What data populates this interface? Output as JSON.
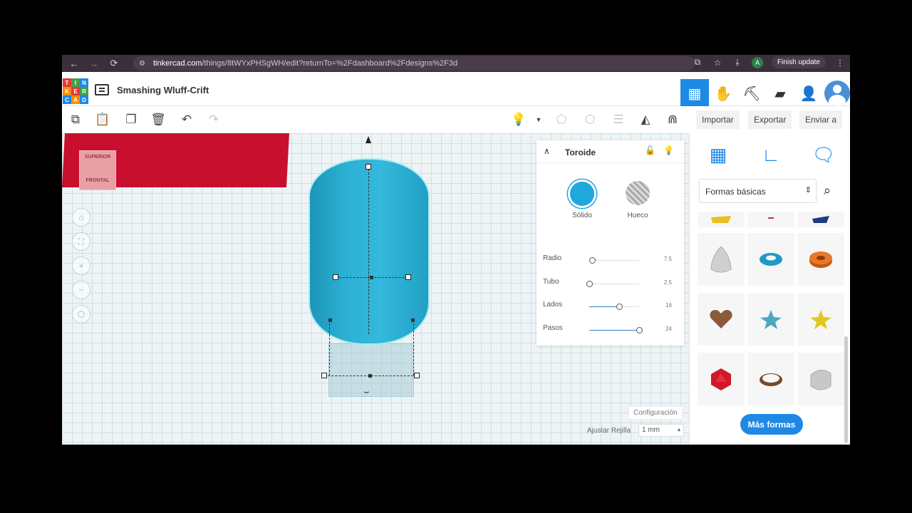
{
  "browser": {
    "url_domain": "tinkercad.com",
    "url_path": "/things/8tWYxPHSgWH/edit?returnTo=%2Fdashboard%2Fdesigns%2F3d",
    "profile_letter": "A",
    "finish_update_label": "Finish update"
  },
  "header": {
    "logo_letters": [
      "T",
      "I",
      "N",
      "K",
      "E",
      "R",
      "C",
      "A",
      "D"
    ],
    "design_title": "Smashing Wluff-Crift"
  },
  "toolbar": {
    "import_label": "Importar",
    "export_label": "Exportar",
    "send_label": "Enviar a"
  },
  "workplane": {
    "view_cube_top": "SUPERIOR",
    "view_cube_front": "FRONTAL",
    "config_label": "Configuración",
    "grid_label": "Ajustar Rejilla",
    "grid_value": "1 mm"
  },
  "inspector": {
    "title": "Toroide",
    "solid_label": "Sólido",
    "hole_label": "Hueco",
    "params": [
      {
        "name": "Radio",
        "value": "7.5",
        "fraction": 0.05
      },
      {
        "name": "Tubo",
        "value": "2.5",
        "fraction": 0.0
      },
      {
        "name": "Lados",
        "value": "16",
        "fraction": 0.6
      },
      {
        "name": "Pasos",
        "value": "24",
        "fraction": 1.0
      }
    ]
  },
  "shapes_panel": {
    "category": "Formas básicas",
    "shapes": [
      "paraboloid",
      "torus-blue",
      "tube-orange",
      "heart",
      "star-blue",
      "star-yellow",
      "icosahedron",
      "ring",
      "round-roof"
    ],
    "more_label": "Más formas"
  },
  "colors": {
    "accent": "#1e88e5",
    "shape": "#2cb0d4",
    "red_block": "#c8102e"
  }
}
